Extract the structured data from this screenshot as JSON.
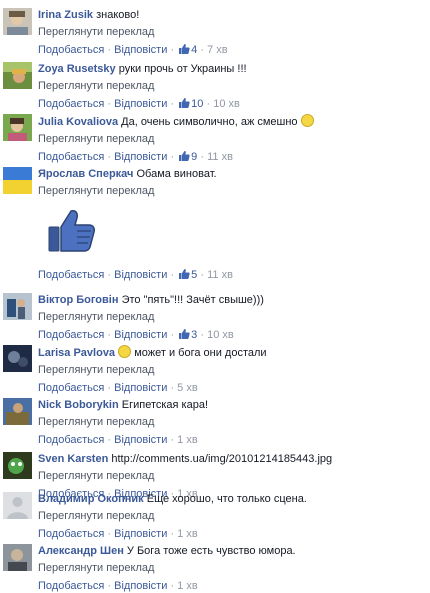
{
  "ui": {
    "like": "Подобається",
    "reply": "Відповісти",
    "translate": "Переглянути переклад",
    "dot": "·"
  },
  "comments": [
    {
      "author": "Irina Zusik",
      "text": "знаково!",
      "likes": "4",
      "time": "7 хв"
    },
    {
      "author": "Zoya Rusetsky",
      "text": "руки прочь от Украины !!!",
      "likes": "10",
      "time": "10 хв"
    },
    {
      "author": "Julia Kovaliova",
      "text": "Да, очень символично, аж смешно",
      "likes": "9",
      "time": "11 хв"
    },
    {
      "author": "Ярослав Сперкач",
      "text": "Обама виноват.",
      "likes": "5",
      "time": "11 хв"
    },
    {
      "author": "Віктор Боговін",
      "text": "Это \"пять\"!!! Зачёт свыше)))",
      "likes": "3",
      "time": "10 хв"
    },
    {
      "author": "Larisa Pavlova",
      "text": "может и бога они достали",
      "time": "5 хв"
    },
    {
      "author": "Nick Boborykin",
      "text": "Египетская кара!",
      "time": "1 хв"
    },
    {
      "author": "Sven Karsten",
      "text": "http://comments.ua/img/20101214185443.jpg",
      "time": "1 хв"
    },
    {
      "author": "Владимир Окопник",
      "text": "Еще хорошо, что только сцена.",
      "time": "1 хв"
    },
    {
      "author": "Александр Шен",
      "text": "У Бога тоже есть чувство юмора.",
      "time": "1 хв"
    }
  ],
  "colors": {
    "author": "#3b5998",
    "like_icon": "#4267b2",
    "meta": "#9197a3"
  },
  "icons": {
    "like": "thumbs-up-icon",
    "smile": "smile-emoji-icon"
  }
}
